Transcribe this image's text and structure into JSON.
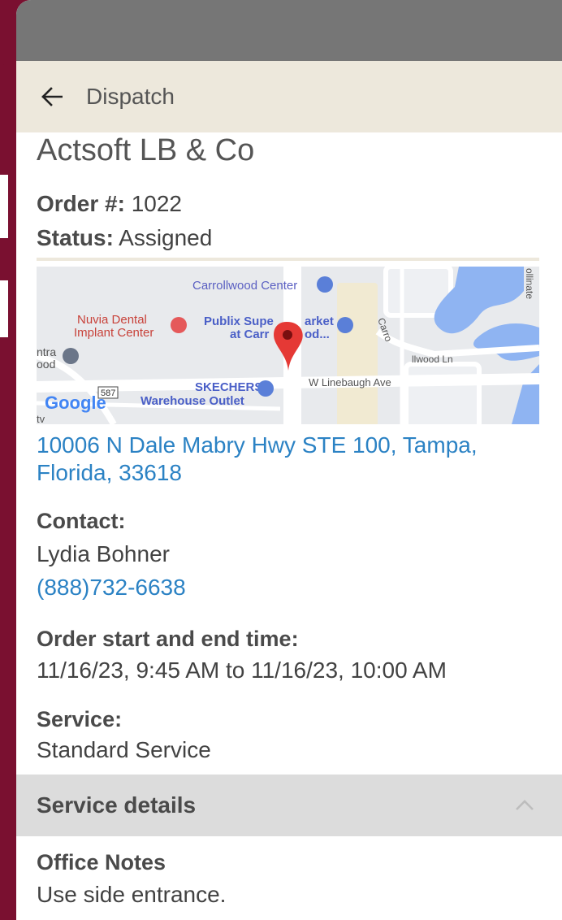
{
  "header": {
    "back_icon": "arrow-left-icon",
    "title": "Dispatch"
  },
  "order": {
    "customer_name": "Actsoft LB & Co",
    "order_label": "Order #:",
    "order_number": " 1022",
    "status_label": "Status:",
    "status_value": " Assigned"
  },
  "map": {
    "places": {
      "carrollwood": "Carrollwood Center",
      "nuvia_1": "Nuvia Dental",
      "nuvia_2": "Implant Center",
      "publix_1": "Publix Supe",
      "publix_1b": "arket",
      "publix_2": "at Carr",
      "publix_2b": "od...",
      "skechers_1": "SKECHERS",
      "skechers_2": "Warehouse Outlet",
      "linebaugh": "W Linebaugh Ave",
      "carrollwood_ln_1": "Carro",
      "carrollwood_ln_2": "llwood Ln",
      "partial_1": "ntra",
      "partial_2": "ood",
      "partial_3": "tv",
      "partial_4": "ollinate",
      "route": "587",
      "google": "Google"
    },
    "pin_color": "#e53935"
  },
  "address": "10006 N Dale Mabry Hwy STE 100, Tampa, Florida, 33618",
  "contact": {
    "label": "Contact:",
    "name": "Lydia Bohner",
    "phone": "(888)732-6638"
  },
  "schedule": {
    "label": "Order start and end time:",
    "value": "11/16/23, 9:45 AM to 11/16/23, 10:00 AM"
  },
  "service": {
    "label": "Service:",
    "value": "Standard Service"
  },
  "service_details": {
    "title": "Service details",
    "chevron_icon": "chevron-up-icon"
  },
  "notes": {
    "label": "Office Notes",
    "value": "Use side entrance."
  },
  "colors": {
    "status_bar": "#767676",
    "header_bg": "#ede8dc",
    "link": "#2b82c4",
    "section_bar": "#dcdcdc",
    "backdrop": "#7a1030"
  }
}
